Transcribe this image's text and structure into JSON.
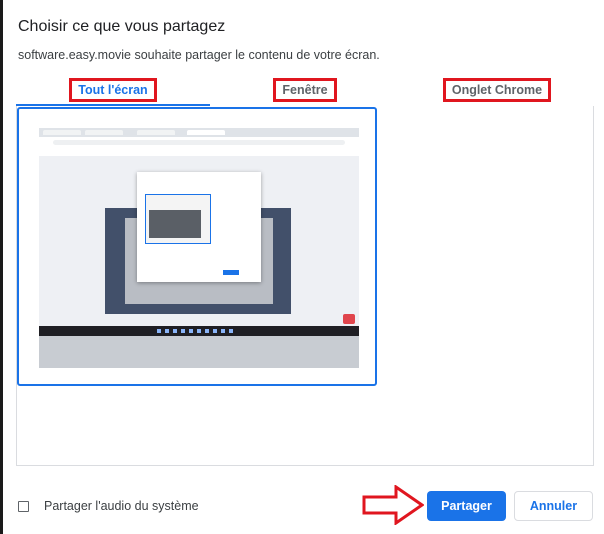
{
  "dialog": {
    "title": "Choisir ce que vous partagez",
    "subtitle": "software.easy.movie souhaite partager le contenu de votre écran."
  },
  "tabs": [
    {
      "label": "Tout l'écran",
      "active": true
    },
    {
      "label": "Fenêtre",
      "active": false
    },
    {
      "label": "Onglet Chrome",
      "active": false
    }
  ],
  "audio": {
    "label": "Partager l'audio du système",
    "checked": false
  },
  "buttons": {
    "share": "Partager",
    "cancel": "Annuler"
  },
  "colors": {
    "accent": "#1a73e8",
    "highlight": "#e0161f"
  }
}
